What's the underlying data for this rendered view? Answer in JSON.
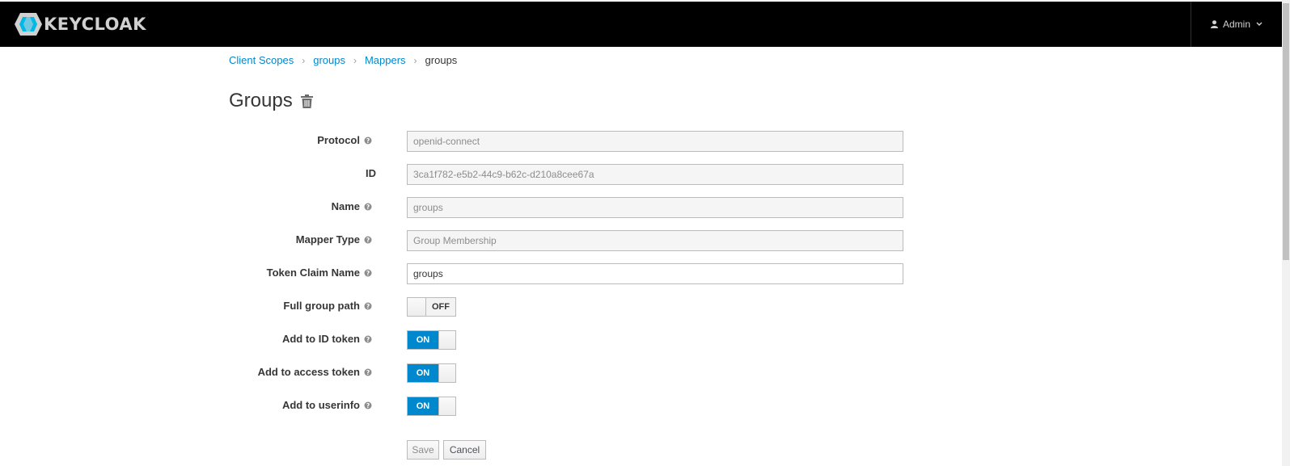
{
  "header": {
    "logo_text": "KEYCLOAK",
    "user_label": "Admin"
  },
  "breadcrumb": {
    "items": [
      "Client Scopes",
      "groups",
      "Mappers"
    ],
    "current": "groups"
  },
  "page": {
    "title": "Groups"
  },
  "form": {
    "protocol": {
      "label": "Protocol",
      "value": "openid-connect"
    },
    "id": {
      "label": "ID",
      "value": "3ca1f782-e5b2-44c9-b62c-d210a8cee67a"
    },
    "name": {
      "label": "Name",
      "value": "groups"
    },
    "mapper_type": {
      "label": "Mapper Type",
      "value": "Group Membership"
    },
    "token_claim_name": {
      "label": "Token Claim Name",
      "value": "groups"
    },
    "full_group_path": {
      "label": "Full group path",
      "state": "OFF"
    },
    "add_to_id_token": {
      "label": "Add to ID token",
      "state": "ON"
    },
    "add_to_access_token": {
      "label": "Add to access token",
      "state": "ON"
    },
    "add_to_userinfo": {
      "label": "Add to userinfo",
      "state": "ON"
    }
  },
  "actions": {
    "save_label": "Save",
    "cancel_label": "Cancel"
  },
  "colors": {
    "accent": "#0088ce",
    "header_bg": "#000000"
  }
}
